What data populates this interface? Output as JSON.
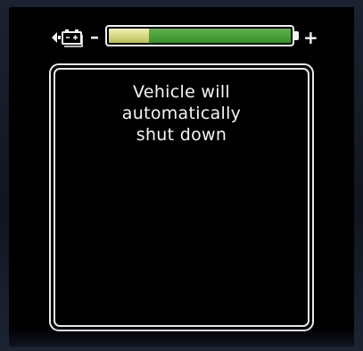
{
  "status_bar": {
    "battery_icon": "vehicle-battery-icon",
    "minus_label": "–",
    "plus_label": "+",
    "charge_level_fraction": 0.22,
    "colors": {
      "gauge_green": "#4ea23d",
      "gauge_low": "#e5e79c",
      "outline": "#f2f2f2"
    }
  },
  "message": {
    "line1": "Vehicle will",
    "line2": "automatically",
    "line3": "shut down"
  }
}
